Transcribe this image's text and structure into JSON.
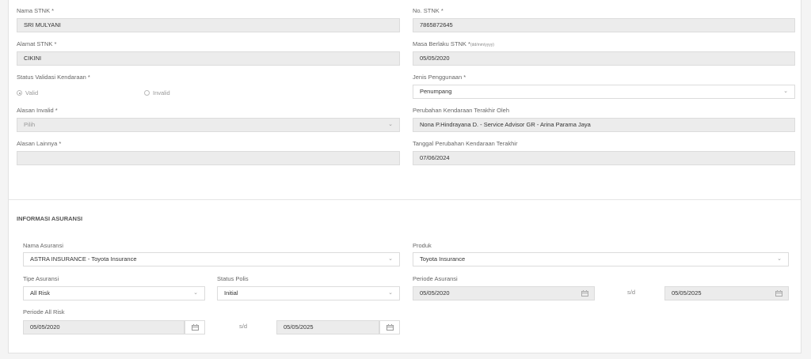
{
  "stnk": {
    "nama_label": "Nama STNK *",
    "nama_value": "SRI MULYANI",
    "no_label": "No. STNK *",
    "no_value": "7865872645",
    "alamat_label": "Alamat STNK *",
    "alamat_value": "CIKINI",
    "masa_label": "Masa Berlaku STNK *",
    "masa_hint": "(dd/mm/yyyy)",
    "masa_value": "05/05/2020",
    "status_label": "Status Validasi Kendaraan *",
    "status_options": [
      "Valid",
      "Invalid"
    ],
    "jenis_label": "Jenis Penggunaan *",
    "jenis_value": "Penumpang",
    "alasan_invalid_label": "Alasan Invalid *",
    "alasan_invalid_value": "Pilih",
    "perubahan_oleh_label": "Perubahan Kendaraan Terakhir Oleh",
    "perubahan_oleh_value": "Nona P.Hindrayana D. - Service Advisor GR - Arina Parama Jaya",
    "alasan_lainnya_label": "Alasan Lainnya *",
    "alasan_lainnya_value": "",
    "tanggal_label": "Tanggal Perubahan Kendaraan Terakhir",
    "tanggal_value": "07/06/2024"
  },
  "asuransi": {
    "section_title": "INFORMASI ASURANSI",
    "nama_label": "Nama Asuransi",
    "nama_value": "ASTRA INSURANCE - Toyota Insurance",
    "produk_label": "Produk",
    "produk_value": "Toyota Insurance",
    "tipe_label": "Tipe Asuransi",
    "tipe_value": "All Risk",
    "status_label": "Status Polis",
    "status_value": "Initial",
    "periode_label": "Periode Asuransi",
    "periode_start": "05/05/2020",
    "periode_sd": "s/d",
    "periode_end": "05/05/2025",
    "allrisk_label": "Periode All Risk",
    "allrisk_start": "05/05/2020",
    "allrisk_sd": "s/d",
    "allrisk_end": "05/05/2025"
  },
  "icons": {
    "dropdown": "chevron-down-icon",
    "calendar": "calendar-icon"
  }
}
